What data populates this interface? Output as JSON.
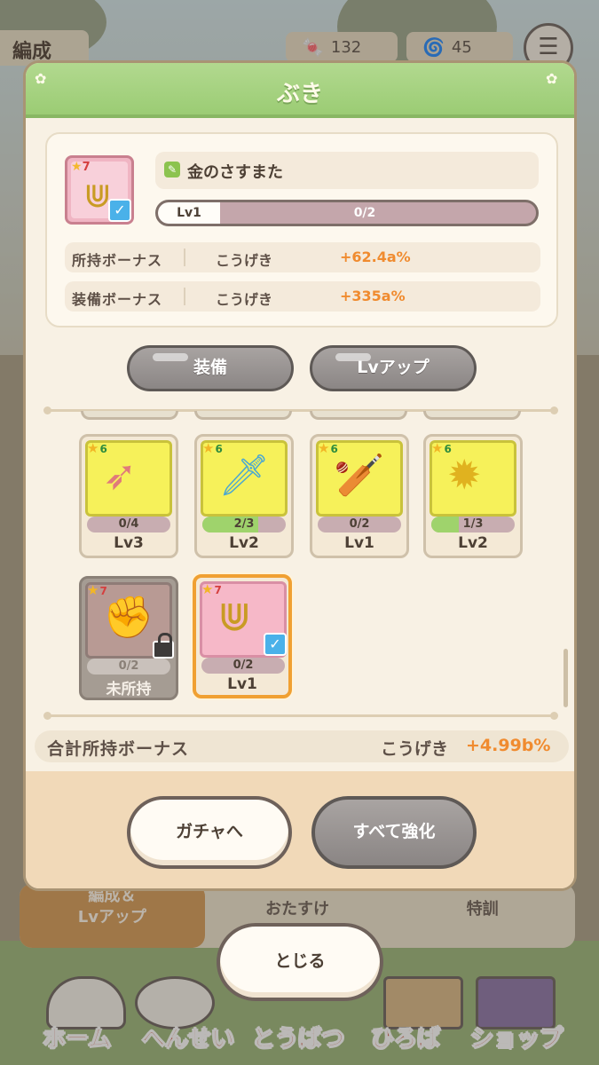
{
  "background": {
    "top_tab": "編成",
    "currencies": [
      {
        "icon": "candy-icon",
        "value": "132"
      },
      {
        "icon": "swirl-icon",
        "value": "45"
      }
    ],
    "behind_tabs": [
      "編成＆\nLvアップ",
      "おたすけ",
      "特訓"
    ],
    "nav": [
      "ホーム",
      "へんせい",
      "とうばつ",
      "ひろば",
      "ショップ"
    ]
  },
  "dialog": {
    "title": "ぶき",
    "selected": {
      "rarity": "7",
      "name": "金のさすまた",
      "lv_label": "Lv1",
      "lv_progress": "0/2",
      "bonuses": [
        {
          "label": "所持ボーナス",
          "stat": "こうげき",
          "value": "+62.4a%"
        },
        {
          "label": "装備ボーナス",
          "stat": "こうげき",
          "value": "+335a%"
        }
      ]
    },
    "buttons": {
      "equip": "装備",
      "levelup": "Lvアップ"
    },
    "weapons": [
      {
        "rarity": "6",
        "progress": "0/4",
        "fill": 0.0,
        "level": "Lv3",
        "style": "yellow",
        "glyph": "➶"
      },
      {
        "rarity": "6",
        "progress": "2/3",
        "fill": 0.667,
        "level": "Lv2",
        "style": "yellow",
        "glyph": "🗡"
      },
      {
        "rarity": "6",
        "progress": "0/2",
        "fill": 0.0,
        "level": "Lv1",
        "style": "yellow",
        "glyph": "🏏"
      },
      {
        "rarity": "6",
        "progress": "1/3",
        "fill": 0.333,
        "level": "Lv2",
        "style": "yellow",
        "glyph": "✹"
      },
      {
        "rarity": "7",
        "progress": "0/2",
        "fill": 0.0,
        "level": "未所持",
        "style": "grey",
        "glyph": "✊"
      },
      {
        "rarity": "7",
        "progress": "0/2",
        "fill": 0.0,
        "level": "Lv1",
        "style": "pink",
        "glyph": "⋓"
      }
    ],
    "total": {
      "label": "合計所持ボーナス",
      "stat": "こうげき",
      "value": "+4.99b%"
    },
    "footer": {
      "gacha": "ガチャへ",
      "upgrade_all": "すべて強化"
    }
  },
  "close_label": "とじる",
  "colors": {
    "accent_orange": "#f08b2f",
    "header_green": "#9bcc74",
    "check_blue": "#4ab1e9"
  }
}
